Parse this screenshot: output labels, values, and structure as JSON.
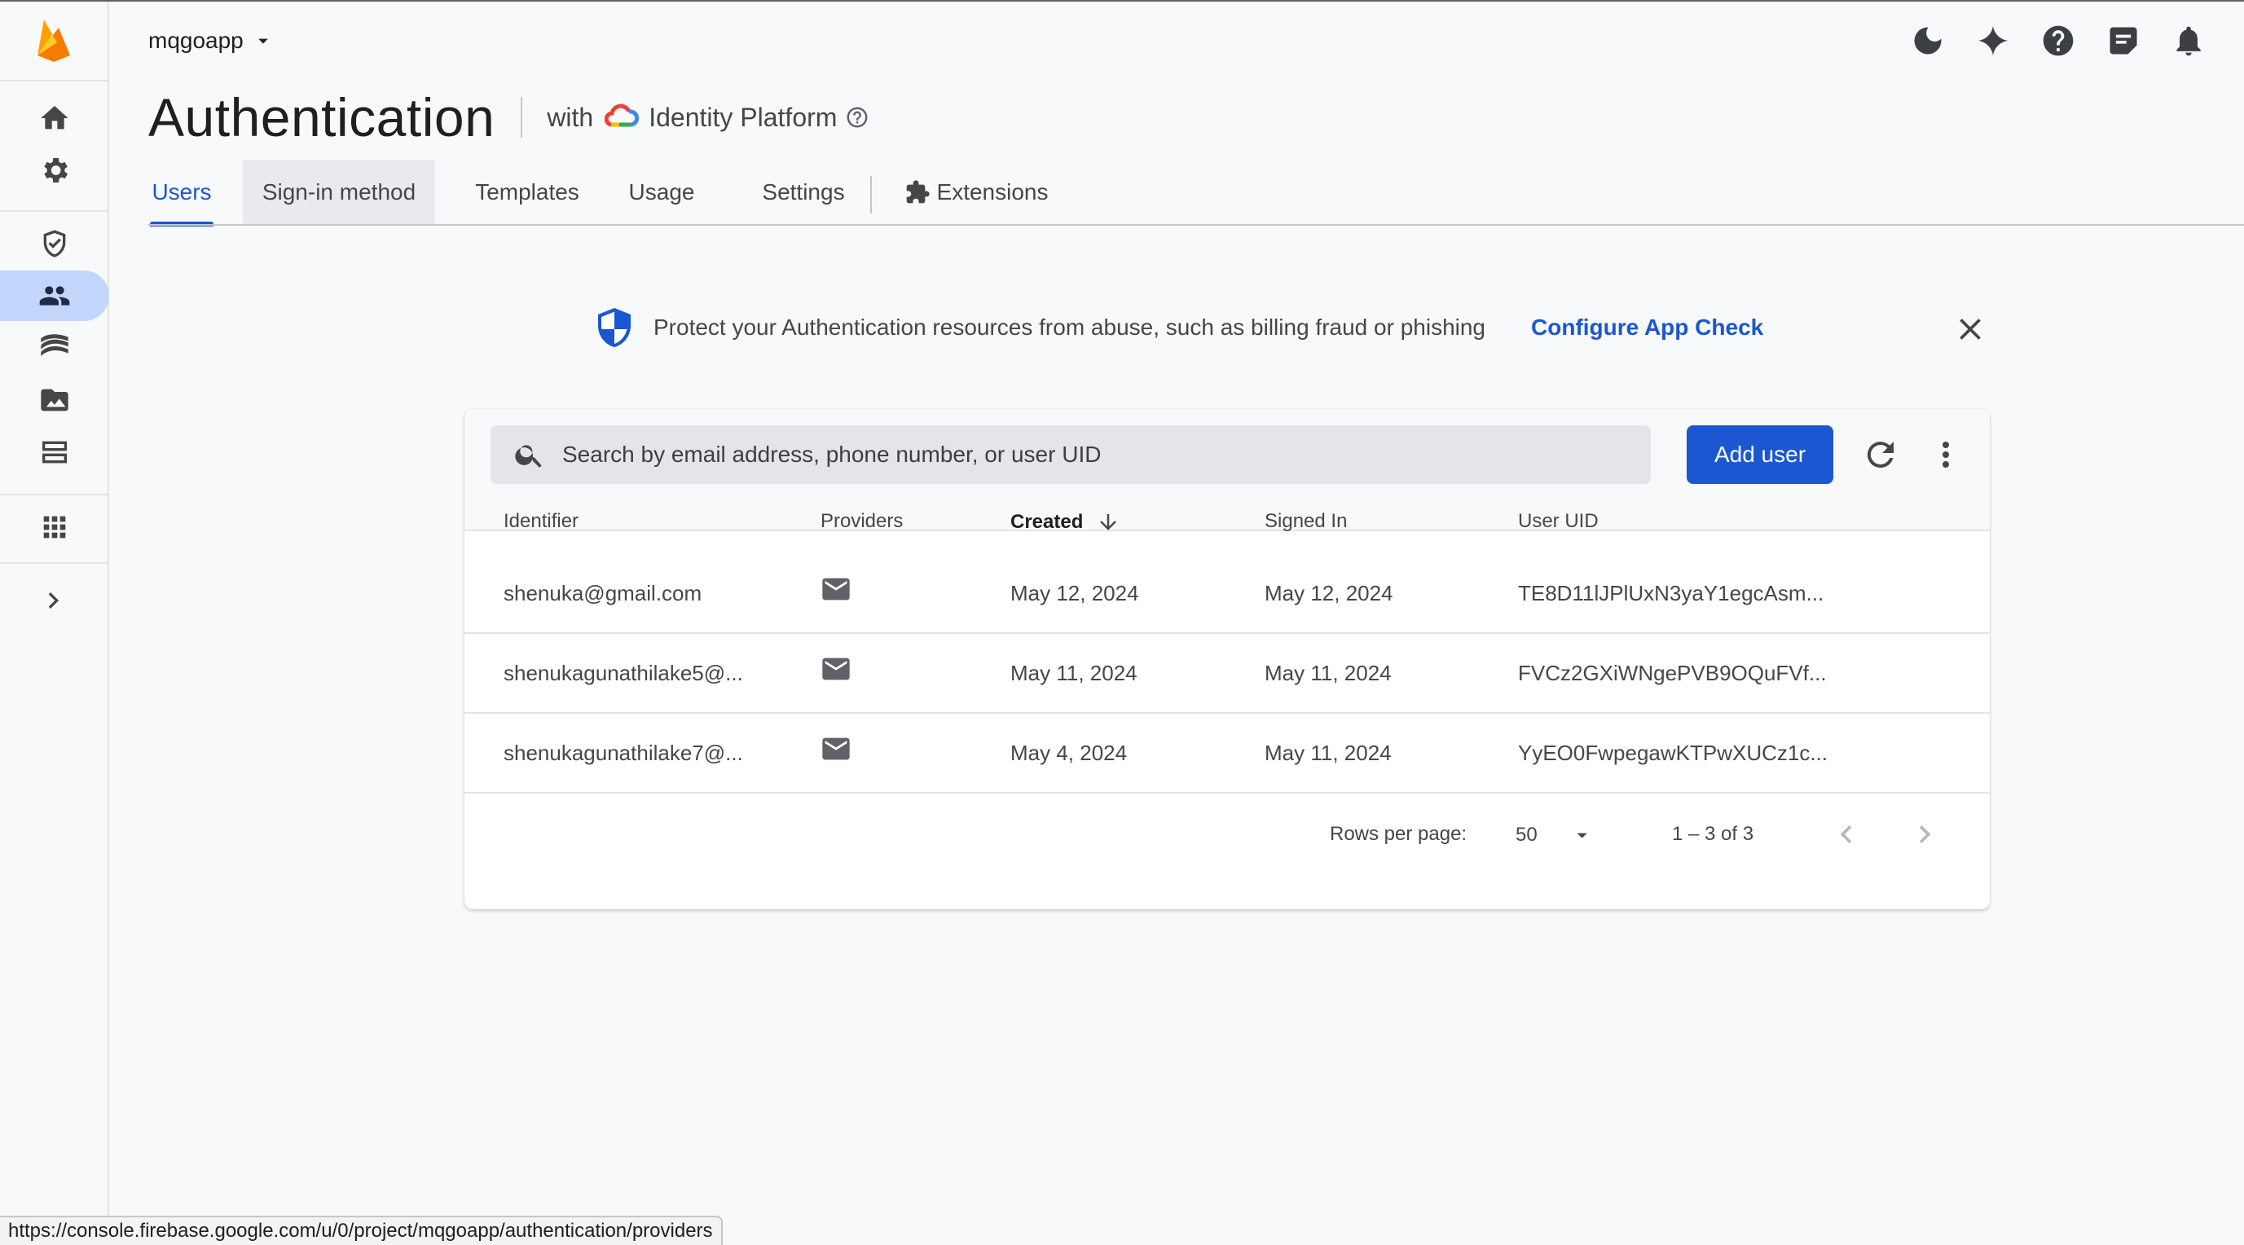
{
  "project": {
    "name": "mqgoapp"
  },
  "header": {
    "title": "Authentication",
    "with_label": "with",
    "platform_label": "Identity Platform"
  },
  "top_icons": [
    "dark-mode-icon",
    "gemini-sparkle-icon",
    "help-icon",
    "feedback-icon",
    "notifications-icon"
  ],
  "tabs": [
    {
      "label": "Users",
      "active": true
    },
    {
      "label": "Sign-in method",
      "active": false
    },
    {
      "label": "Templates",
      "active": false
    },
    {
      "label": "Usage",
      "active": false
    },
    {
      "label": "Settings",
      "active": false
    },
    {
      "label": "Extensions",
      "active": false
    }
  ],
  "banner": {
    "text": "Protect your Authentication resources from abuse, such as billing fraud or phishing",
    "link": "Configure App Check"
  },
  "search": {
    "placeholder": "Search by email address, phone number, or user UID",
    "value": ""
  },
  "toolbar": {
    "add_user_label": "Add user"
  },
  "table": {
    "columns": [
      "Identifier",
      "Providers",
      "Created",
      "Signed In",
      "User UID"
    ],
    "sorted_column": "Created",
    "rows": [
      {
        "identifier": "shenuka@gmail.com",
        "provider": "email-icon",
        "created": "May 12, 2024",
        "signed_in": "May 12, 2024",
        "uid": "TE8D11lJPlUxN3yaY1egcAsm..."
      },
      {
        "identifier": "shenukagunathilake5@...",
        "provider": "email-icon",
        "created": "May 11, 2024",
        "signed_in": "May 11, 2024",
        "uid": "FVCz2GXiWNgePVB9OQuFVf..."
      },
      {
        "identifier": "shenukagunathilake7@...",
        "provider": "email-icon",
        "created": "May 4, 2024",
        "signed_in": "May 11, 2024",
        "uid": "YyEO0FwpegawKTPwXUCz1c..."
      }
    ]
  },
  "pagination": {
    "rows_per_page_label": "Rows per page:",
    "rows_per_page": "50",
    "range": "1 – 3 of 3"
  },
  "statusbar": {
    "url": "https://console.firebase.google.com/u/0/project/mqgoapp/authentication/providers"
  },
  "colors": {
    "accent": "#1a57d1",
    "active_nav": "#c2d6fb",
    "background": "#f8f9fa"
  }
}
